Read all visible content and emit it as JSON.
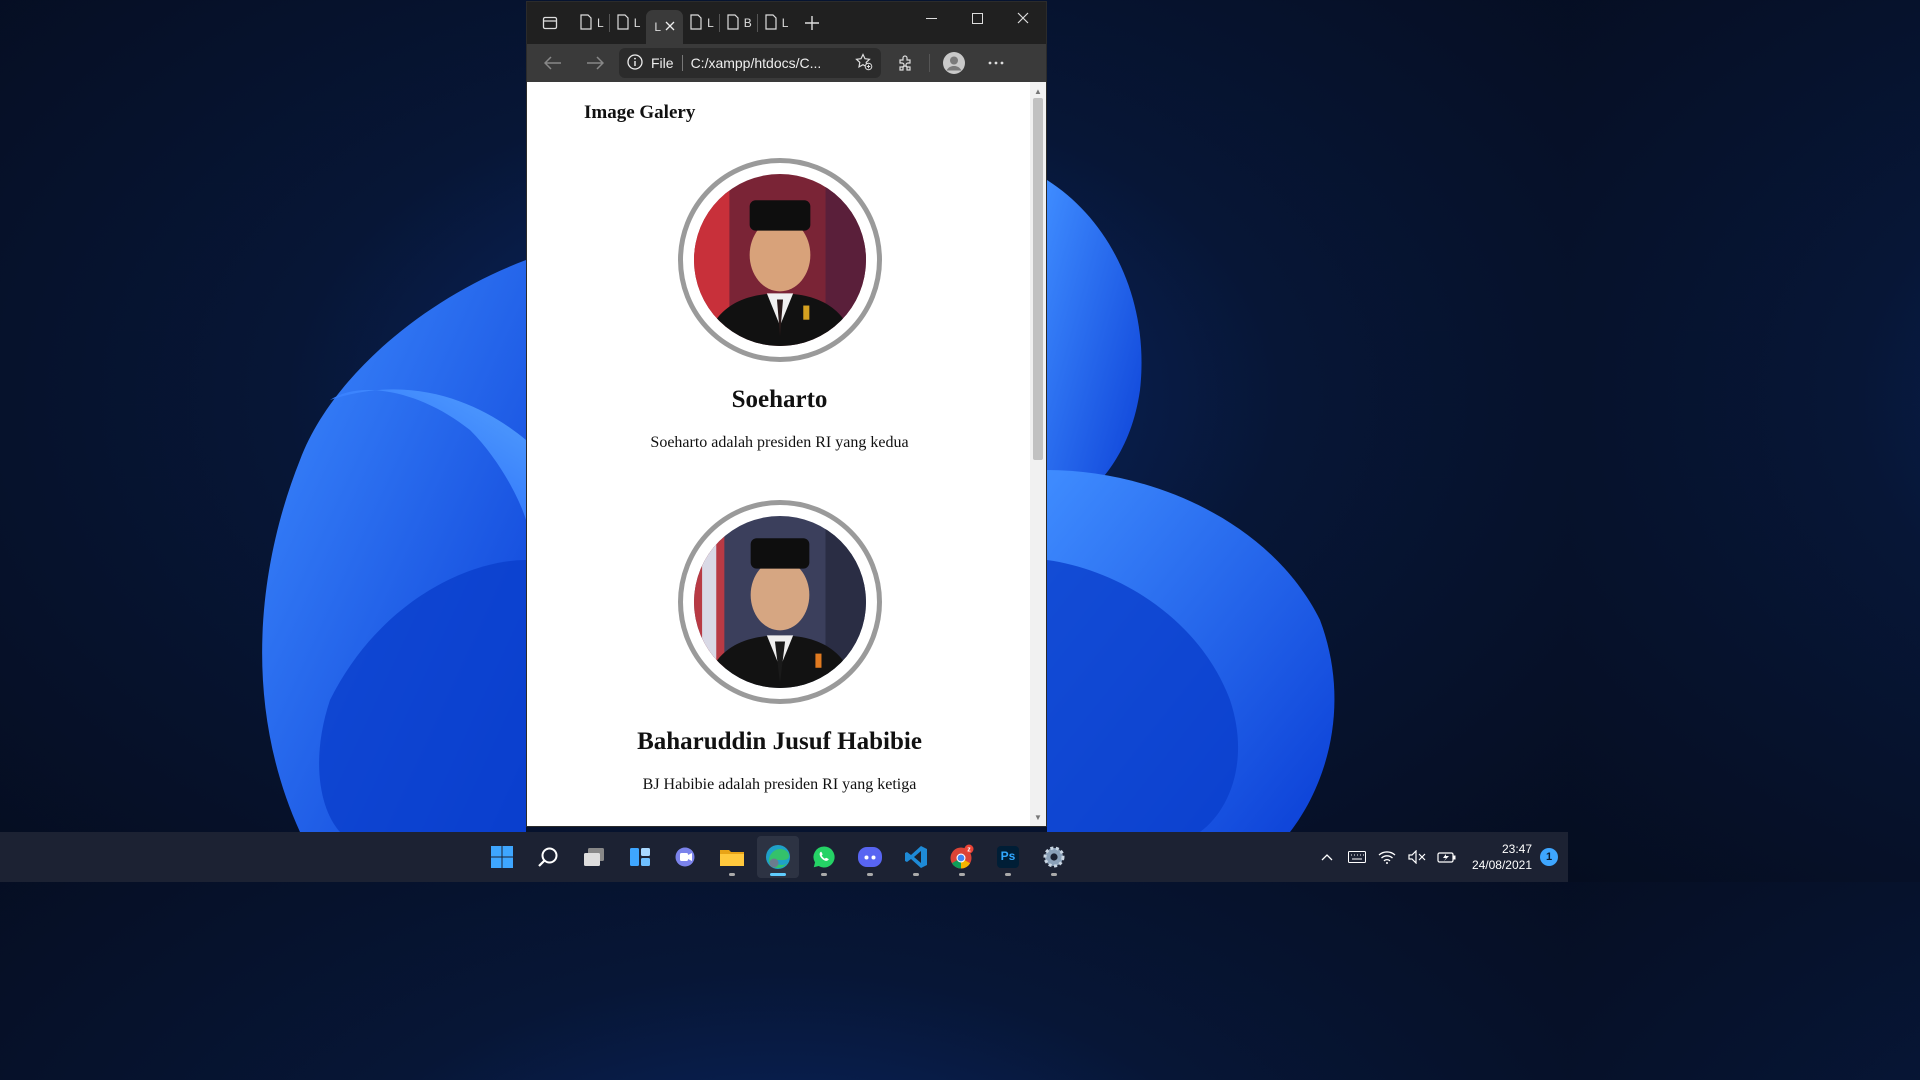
{
  "browser": {
    "tabs": [
      {
        "label": "L",
        "icon": "page-icon",
        "active": false
      },
      {
        "label": "L",
        "icon": "page-icon",
        "active": false
      },
      {
        "label": "L",
        "icon": "page-icon",
        "active": true
      },
      {
        "label": "L",
        "icon": "page-icon",
        "active": false
      },
      {
        "label": "B",
        "icon": "page-icon",
        "active": false
      },
      {
        "label": "L",
        "icon": "page-icon",
        "active": false
      }
    ],
    "address": {
      "scheme_label": "File",
      "url": "C:/xampp/htdocs/C..."
    }
  },
  "page": {
    "title": "Image Galery",
    "gallery": [
      {
        "name": "Soeharto",
        "description": "Soeharto adalah presiden RI yang kedua"
      },
      {
        "name": "Baharuddin Jusuf Habibie",
        "description": "BJ Habibie adalah presiden RI yang ketiga"
      }
    ]
  },
  "taskbar": {
    "apps": [
      "windows-start-icon",
      "search-icon",
      "task-view-icon",
      "widgets-icon",
      "teams-chat-icon",
      "file-explorer-icon",
      "edge-icon",
      "whatsapp-icon",
      "discord-icon",
      "vscode-icon",
      "chrome-icon",
      "photoshop-icon",
      "settings-icon"
    ],
    "photoshop_label": "Ps",
    "clock": {
      "time": "23:47",
      "date": "24/08/2021"
    },
    "notification_count": "1"
  },
  "colors": {
    "accent": "#60cdff",
    "ring": "#9a9a9a",
    "titlebar": "#202020",
    "toolbar": "#3a3a3a"
  }
}
